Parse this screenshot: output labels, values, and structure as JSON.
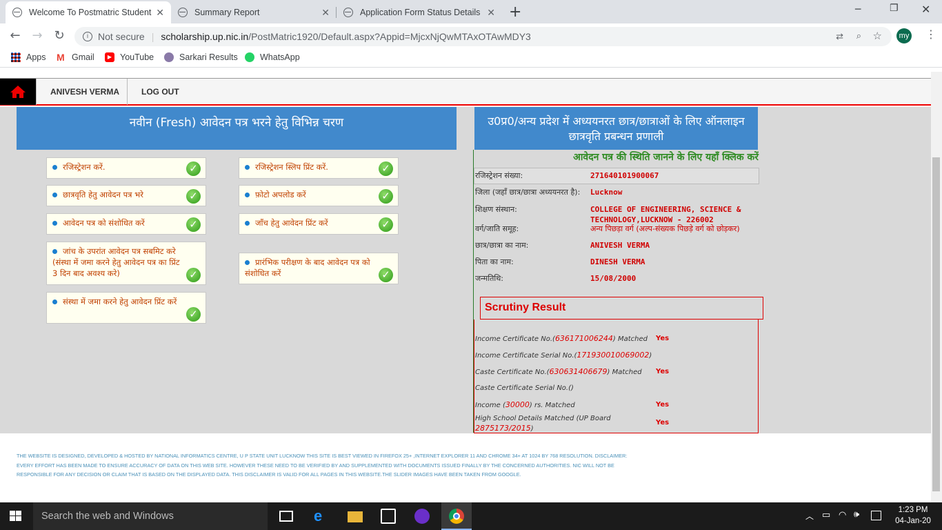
{
  "browser": {
    "tabs": [
      {
        "title": "Welcome To Postmatric Students"
      },
      {
        "title": "Summary Report"
      },
      {
        "title": "Application Form Status Details"
      }
    ],
    "security": "Not secure",
    "url_host": "scholarship.up.nic.in",
    "url_path": "/PostMatric1920/Default.aspx?Appid=MjcxNjQwMTAxOTAwMDY3",
    "profile": "my",
    "bookmarks": [
      "Apps",
      "Gmail",
      "YouTube",
      "Sarkari Results",
      "WhatsApp"
    ]
  },
  "nav": {
    "user": "ANIVESH VERMA",
    "logout": "LOG OUT"
  },
  "left": {
    "heading": "नवीन (Fresh) आवेदन पत्र भरने हेतु विभिन्न चरण",
    "steps": [
      "रजिस्ट्रेशन करें.",
      "छात्रवृति हेतु आवेदन पत्र भरे",
      "आवेदन पत्र को संशोधित करें",
      "जांच के उपरांत आवेदन पत्र सबमिट करे (संस्था में जमा करने हेतु आवेदन पत्र का प्रिंट 3 दिन बाद अवश्य करे)",
      "संस्था में जमा करने हेतु आवेदन प्रिंट करें",
      "रजिस्ट्रेशन स्लिप प्रिंट करें.",
      "फ़ोटो अपलोड करें",
      "जाँच हेतु आवेदन प्रिंट करें",
      "प्रारंभिक परीक्षण के बाद आवेदन पत्र को संशोधित करें"
    ]
  },
  "right": {
    "heading": "उ0प्र0/अन्य प्रदेश में अध्ययनरत छात्र/छात्राओं के लिए ऑनलाइन छात्रवृति प्रबन्धन प्रणाली",
    "status_link": "आवेदन पत्र की स्थिति जानने के लिए यहाँ क्लिक करें",
    "details": [
      {
        "label": "रजिस्ट्रेशन संख्या:",
        "value": "271640101900067"
      },
      {
        "label": "जिला (जहाँ छात्र/छात्रा अध्ययनरत है):",
        "value": "Lucknow"
      },
      {
        "label": "शिक्षण संस्थान:",
        "value": "COLLEGE OF ENGINEERING, SCIENCE & TECHNOLOGY,LUCKNOW - 226002"
      },
      {
        "label": "वर्ग/जाति समूह:",
        "value": "अन्य पिछड़ा वर्ग (अल्प-संख्यक पिछड़े वर्ग को छोड़कर)"
      },
      {
        "label": "छात्र/छात्रा का नाम:",
        "value": "ANIVESH VERMA"
      },
      {
        "label": "पिता का नाम:",
        "value": "DINESH VERMA"
      },
      {
        "label": "जन्मतिथि:",
        "value": "15/08/2000"
      }
    ],
    "scrutiny_title": "Scrutiny Result",
    "scrutiny": [
      {
        "pre": "Income Certificate No.(",
        "num": "636171006244",
        "post": ") Matched",
        "result": "Yes"
      },
      {
        "pre": "Income Certificate Serial No.(",
        "num": "171930010069002",
        "post": ")",
        "result": ""
      },
      {
        "pre": "Caste Certificate No.(",
        "num": "630631406679",
        "post": ") Matched",
        "result": "Yes"
      },
      {
        "pre": "Caste Certificate Serial No.()",
        "num": "",
        "post": "",
        "result": ""
      },
      {
        "pre": "Income (",
        "num": "30000",
        "post": ") rs. Matched",
        "result": "Yes"
      },
      {
        "pre": "High School Details Matched (UP Board ",
        "num": "2875173/2015",
        "post": ")",
        "result": "Yes"
      }
    ]
  },
  "footer": {
    "disclaimer": "THE WEBSITE IS DESIGNED, DEVELOPED & HOSTED BY NATIONAL INFORMATICS CENTRE, U P STATE UNIT LUCKNOW THIS SITE IS BEST VIEWED IN FIREFOX 25+ ,INTERNET EXPLORER 11 AND CHROME 34+ AT 1024 BY 768 RESOLUTION. DISCLAIMER: EVERY EFFORT HAS BEEN MADE TO ENSURE ACCURACY OF DATA ON THIS WEB SITE. HOWEVER THESE NEED TO BE VERIFIED BY AND SUPPLEMENTED WITH DOCUMENTS ISSUED FINALLY BY THE CONCERNED AUTHORITIES. NIC WILL NOT BE RESPONSIBLE FOR ANY DECISION OR CLAIM THAT IS BASED ON THE DISPLAYED DATA. THIS DISCLAIMER IS VALID FOR ALL PAGES IN THIS WEBSITE.THE SLIDER IMAGES HAVE BEEN TAKEN FROM GOOGLE."
  },
  "taskbar": {
    "search": "Search the web and Windows",
    "time": "1:23 PM",
    "date": "04-Jan-20"
  }
}
